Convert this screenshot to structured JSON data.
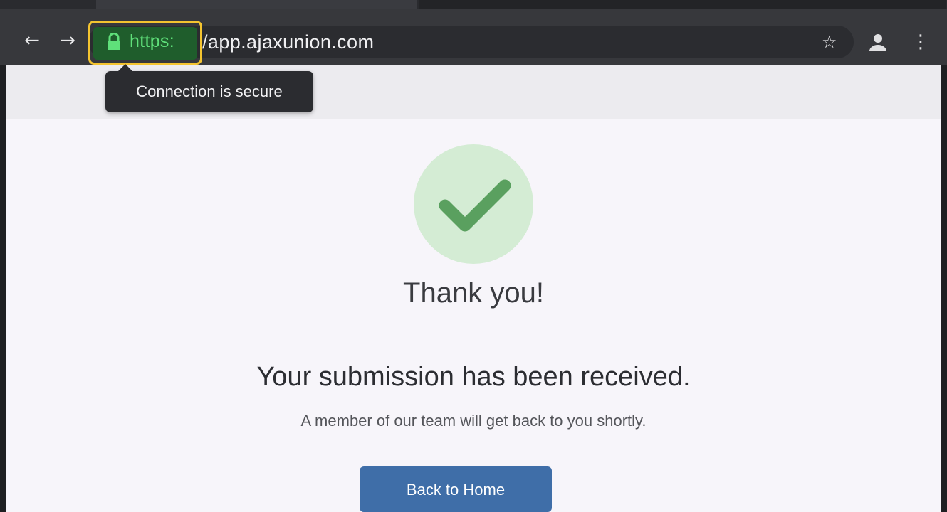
{
  "browser": {
    "url_scheme": "https:",
    "url_host": "/app.ajaxunion.com",
    "tooltip": "Connection is secure",
    "nav": {
      "back_glyph": "←",
      "forward_glyph": "→"
    },
    "icons": {
      "lock": "lock-icon",
      "star": "star-icon",
      "profile": "profile-icon",
      "menu": "more-vertical-icon"
    },
    "star_glyph": "☆",
    "menu_glyph": "⋮",
    "colors": {
      "highlight_border": "#f4c430",
      "secure_green": "#5fe07a"
    }
  },
  "page": {
    "title": "Thank you!",
    "headline": "Your submission has been received.",
    "subtext": "A member of our team will get back to you shortly.",
    "button_label": "Back to Home",
    "colors": {
      "check_circle_bg": "#d4ecd4",
      "check_mark": "#5aa05f",
      "button_bg": "#3f6ea8"
    }
  }
}
